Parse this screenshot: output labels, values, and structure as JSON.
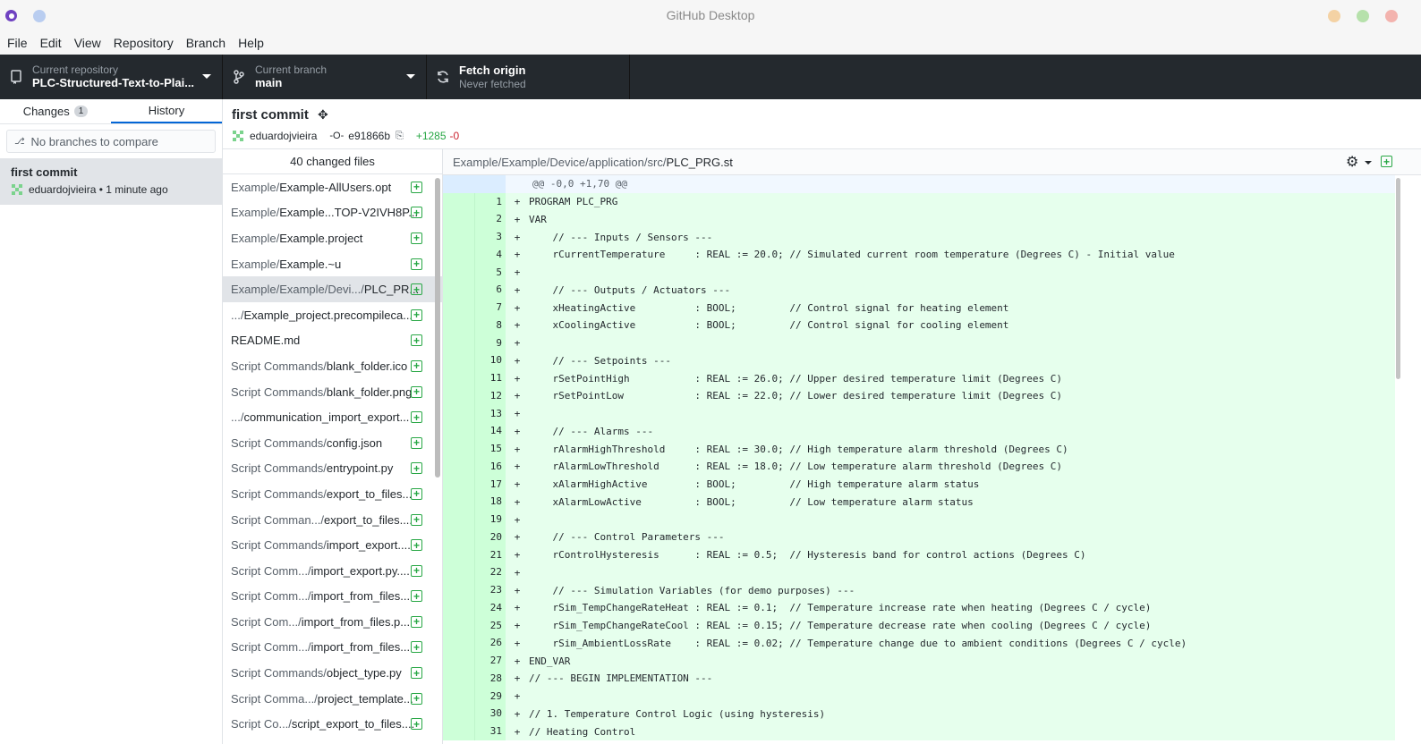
{
  "window": {
    "title": "GitHub Desktop"
  },
  "menu": [
    "File",
    "Edit",
    "View",
    "Repository",
    "Branch",
    "Help"
  ],
  "toolbar": {
    "repo_label": "Current repository",
    "repo_value": "PLC-Structured-Text-to-Plai...",
    "branch_label": "Current branch",
    "branch_value": "main",
    "fetch_label": "Fetch origin",
    "fetch_sub": "Never fetched"
  },
  "sidebar": {
    "tab_changes": "Changes",
    "tab_changes_count": "1",
    "tab_history": "History",
    "compare_placeholder": "No branches to compare",
    "commit": {
      "title": "first commit",
      "meta": "eduardojvieira • 1 minute ago"
    }
  },
  "commit_header": {
    "title": "first commit",
    "author": "eduardojvieira",
    "sha": "e91866b",
    "additions": "+1285",
    "deletions": "-0"
  },
  "filelist": {
    "header": "40 changed files",
    "files": [
      {
        "dir": "Example/",
        "name": "Example-AllUsers.opt"
      },
      {
        "dir": "Example/",
        "name": "Example...TOP-V2IVH8P..."
      },
      {
        "dir": "Example/",
        "name": "Example.project"
      },
      {
        "dir": "Example/",
        "name": "Example.~u"
      },
      {
        "dir": "Example/Example/Devi.../",
        "name": "PLC_PR..."
      },
      {
        "dir": ".../",
        "name": "Example_project.precompileca..."
      },
      {
        "dir": "",
        "name": "README.md"
      },
      {
        "dir": "Script Commands/",
        "name": "blank_folder.ico"
      },
      {
        "dir": "Script Commands/",
        "name": "blank_folder.png"
      },
      {
        "dir": ".../",
        "name": "communication_import_export..."
      },
      {
        "dir": "Script Commands/",
        "name": "config.json"
      },
      {
        "dir": "Script Commands/",
        "name": "entrypoint.py"
      },
      {
        "dir": "Script Commands/",
        "name": "export_to_files..."
      },
      {
        "dir": "Script Comman.../",
        "name": "export_to_files...."
      },
      {
        "dir": "Script Commands/",
        "name": "import_export...."
      },
      {
        "dir": "Script Comm.../",
        "name": "import_export.py...."
      },
      {
        "dir": "Script Comm.../",
        "name": "import_from_files..."
      },
      {
        "dir": "Script Com.../",
        "name": "import_from_files.p..."
      },
      {
        "dir": "Script Comm.../",
        "name": "import_from_files..."
      },
      {
        "dir": "Script Commands/",
        "name": "object_type.py"
      },
      {
        "dir": "Script Comma.../",
        "name": "project_template..."
      },
      {
        "dir": "Script Co.../",
        "name": "script_export_to_files...."
      }
    ]
  },
  "diff": {
    "path_dir": "Example/Example/Device/application/src/",
    "path_name": "PLC_PRG.st",
    "hunk": "@@ -0,0 +1,70 @@",
    "lines": [
      {
        "n": "1",
        "code": "PROGRAM PLC_PRG"
      },
      {
        "n": "2",
        "code": "VAR"
      },
      {
        "n": "3",
        "code": "    // --- Inputs / Sensors ---"
      },
      {
        "n": "4",
        "code": "    rCurrentTemperature     : REAL := 20.0; // Simulated current room temperature (Degrees C) - Initial value"
      },
      {
        "n": "5",
        "code": ""
      },
      {
        "n": "6",
        "code": "    // --- Outputs / Actuators ---"
      },
      {
        "n": "7",
        "code": "    xHeatingActive          : BOOL;         // Control signal for heating element"
      },
      {
        "n": "8",
        "code": "    xCoolingActive          : BOOL;         // Control signal for cooling element"
      },
      {
        "n": "9",
        "code": ""
      },
      {
        "n": "10",
        "code": "    // --- Setpoints ---"
      },
      {
        "n": "11",
        "code": "    rSetPointHigh           : REAL := 26.0; // Upper desired temperature limit (Degrees C)"
      },
      {
        "n": "12",
        "code": "    rSetPointLow            : REAL := 22.0; // Lower desired temperature limit (Degrees C)"
      },
      {
        "n": "13",
        "code": ""
      },
      {
        "n": "14",
        "code": "    // --- Alarms ---"
      },
      {
        "n": "15",
        "code": "    rAlarmHighThreshold     : REAL := 30.0; // High temperature alarm threshold (Degrees C)"
      },
      {
        "n": "16",
        "code": "    rAlarmLowThreshold      : REAL := 18.0; // Low temperature alarm threshold (Degrees C)"
      },
      {
        "n": "17",
        "code": "    xAlarmHighActive        : BOOL;         // High temperature alarm status"
      },
      {
        "n": "18",
        "code": "    xAlarmLowActive         : BOOL;         // Low temperature alarm status"
      },
      {
        "n": "19",
        "code": ""
      },
      {
        "n": "20",
        "code": "    // --- Control Parameters ---"
      },
      {
        "n": "21",
        "code": "    rControlHysteresis      : REAL := 0.5;  // Hysteresis band for control actions (Degrees C)"
      },
      {
        "n": "22",
        "code": ""
      },
      {
        "n": "23",
        "code": "    // --- Simulation Variables (for demo purposes) ---"
      },
      {
        "n": "24",
        "code": "    rSim_TempChangeRateHeat : REAL := 0.1;  // Temperature increase rate when heating (Degrees C / cycle)"
      },
      {
        "n": "25",
        "code": "    rSim_TempChangeRateCool : REAL := 0.15; // Temperature decrease rate when cooling (Degrees C / cycle)"
      },
      {
        "n": "26",
        "code": "    rSim_AmbientLossRate    : REAL := 0.02; // Temperature change due to ambient conditions (Degrees C / cycle)"
      },
      {
        "n": "27",
        "code": "END_VAR"
      },
      {
        "n": "28",
        "code": "// --- BEGIN IMPLEMENTATION ---"
      },
      {
        "n": "29",
        "code": ""
      },
      {
        "n": "30",
        "code": "// 1. Temperature Control Logic (using hysteresis)"
      },
      {
        "n": "31",
        "code": "// Heating Control"
      }
    ]
  }
}
